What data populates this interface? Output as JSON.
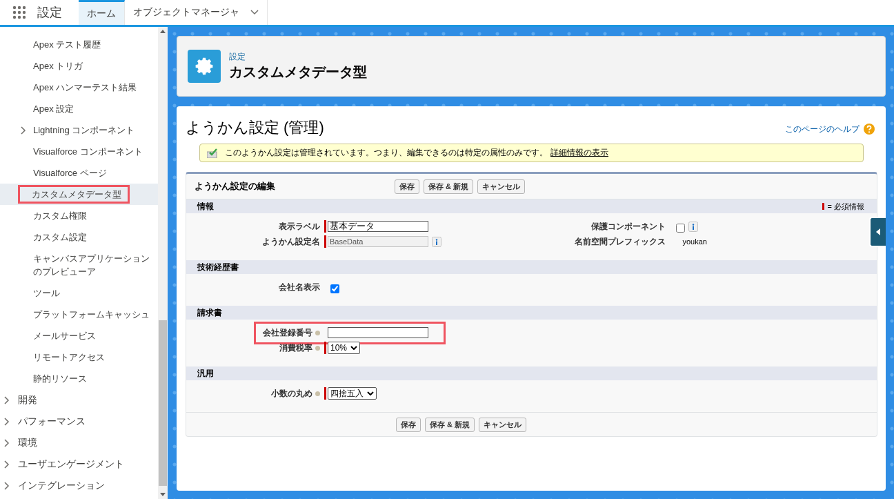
{
  "topbar": {
    "app_title": "設定",
    "tabs": [
      {
        "label": "ホーム",
        "selected": true,
        "menu": false
      },
      {
        "label": "オブジェクトマネージャ",
        "selected": false,
        "menu": true
      }
    ]
  },
  "sidebar": {
    "items": [
      {
        "label": "Apex テスト履歴",
        "kind": "leaf",
        "selected": false,
        "highlighted": false
      },
      {
        "label": "Apex トリガ",
        "kind": "leaf",
        "selected": false,
        "highlighted": false
      },
      {
        "label": "Apex ハンマーテスト結果",
        "kind": "leaf",
        "selected": false,
        "highlighted": false
      },
      {
        "label": "Apex 設定",
        "kind": "leaf",
        "selected": false,
        "highlighted": false
      },
      {
        "label": "Lightning コンポーネント",
        "kind": "folder",
        "selected": false,
        "highlighted": false
      },
      {
        "label": "Visualforce コンポーネント",
        "kind": "leaf",
        "selected": false,
        "highlighted": false
      },
      {
        "label": "Visualforce ページ",
        "kind": "leaf",
        "selected": false,
        "highlighted": false
      },
      {
        "label": "カスタムメタデータ型",
        "kind": "leaf",
        "selected": true,
        "highlighted": true
      },
      {
        "label": "カスタム権限",
        "kind": "leaf",
        "selected": false,
        "highlighted": false
      },
      {
        "label": "カスタム設定",
        "kind": "leaf",
        "selected": false,
        "highlighted": false
      },
      {
        "label": "キャンバスアプリケーションのプレビューア",
        "kind": "leaf",
        "selected": false,
        "highlighted": false
      },
      {
        "label": "ツール",
        "kind": "leaf",
        "selected": false,
        "highlighted": false
      },
      {
        "label": "プラットフォームキャッシュ",
        "kind": "leaf",
        "selected": false,
        "highlighted": false
      },
      {
        "label": "メールサービス",
        "kind": "leaf",
        "selected": false,
        "highlighted": false
      },
      {
        "label": "リモートアクセス",
        "kind": "leaf",
        "selected": false,
        "highlighted": false
      },
      {
        "label": "静的リソース",
        "kind": "leaf",
        "selected": false,
        "highlighted": false
      }
    ],
    "groups": [
      {
        "label": "開発",
        "expanded": false
      },
      {
        "label": "パフォーマンス",
        "expanded": false
      },
      {
        "label": "環境",
        "expanded": false
      },
      {
        "label": "ユーザエンゲージメント",
        "expanded": false
      },
      {
        "label": "インテグレーション",
        "expanded": false
      }
    ]
  },
  "page_header": {
    "breadcrumb": "設定",
    "title": "カスタムメタデータ型"
  },
  "content": {
    "title": "ようかん設定 (管理)",
    "help_link": "このページのヘルプ",
    "notice": {
      "text": "このようかん設定は管理されています。つまり、編集できるのは特定の属性のみです。",
      "link": "詳細情報の表示"
    },
    "form": {
      "title": "ようかん設定の編集",
      "buttons": [
        "保存",
        "保存 & 新規",
        "キャンセル"
      ],
      "required_legend": "= 必須情報",
      "sections": [
        {
          "title": "情報",
          "rows": [
            {
              "left": {
                "label": "表示ラベル",
                "kind": "text",
                "value": "基本データ",
                "required": true,
                "highlighted": false
              },
              "right": {
                "label": "保護コンポーネント",
                "kind": "checkbox",
                "checked": false,
                "required": false,
                "info_button": true,
                "highlighted": false
              }
            },
            {
              "left": {
                "label": "ようかん設定名",
                "kind": "readonly",
                "value": "BaseData",
                "required": true,
                "info_button": true,
                "highlighted": false
              },
              "right": {
                "label": "名前空間プレフィックス",
                "kind": "static",
                "value": "youkan",
                "required": false,
                "highlighted": false
              }
            }
          ]
        },
        {
          "title": "技術経歴書",
          "rows": [
            {
              "left": {
                "label": "会社名表示",
                "kind": "checkbox",
                "checked": true,
                "required": false,
                "highlighted": false
              }
            }
          ]
        },
        {
          "title": "請求書",
          "rows": [
            {
              "left": {
                "label": "会社登録番号",
                "kind": "text",
                "required": false,
                "hint_icon": true,
                "highlighted": true
              }
            },
            {
              "left": {
                "label": "消費税率",
                "kind": "select",
                "value": "10%",
                "required": true,
                "hint_icon": true,
                "highlighted": false
              }
            }
          ]
        },
        {
          "title": "汎用",
          "rows": [
            {
              "left": {
                "label": "小数の丸め",
                "kind": "select",
                "value": "四捨五入",
                "required": true,
                "hint_icon": true,
                "highlighted": false
              }
            }
          ]
        }
      ],
      "bottom_buttons": [
        "保存",
        "保存 & 新規",
        "キャンセル"
      ]
    }
  }
}
